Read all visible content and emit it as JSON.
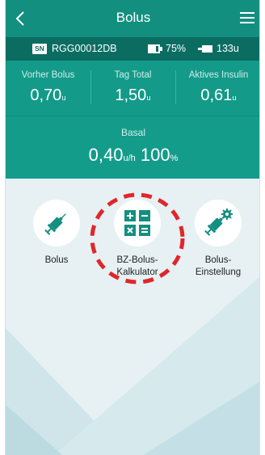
{
  "header": {
    "title": "Bolus"
  },
  "status": {
    "serial_badge": "SN",
    "serial": "RGG00012DB",
    "battery": "75%",
    "reservoir": "133u"
  },
  "stats": [
    {
      "label": "Vorher Bolus",
      "value": "0,70",
      "unit": "u"
    },
    {
      "label": "Tag Total",
      "value": "1,50",
      "unit": "u"
    },
    {
      "label": "Aktives Insulin",
      "value": "0,61",
      "unit": "u"
    }
  ],
  "basal": {
    "label": "Basal",
    "rate": "0,40",
    "rate_unit": "u/h",
    "percent": "100",
    "percent_unit": "%"
  },
  "actions": [
    {
      "label": "Bolus",
      "icon": "syringe-icon"
    },
    {
      "label": "BZ-Bolus-\nKalkulator",
      "icon": "calculator-icon"
    },
    {
      "label": "Bolus-\nEinstellung",
      "icon": "syringe-settings-icon"
    }
  ],
  "colors": {
    "header": "#138f80",
    "status_bar": "#0b6d62",
    "panel": "#139a89",
    "highlight": "#e0262b"
  }
}
